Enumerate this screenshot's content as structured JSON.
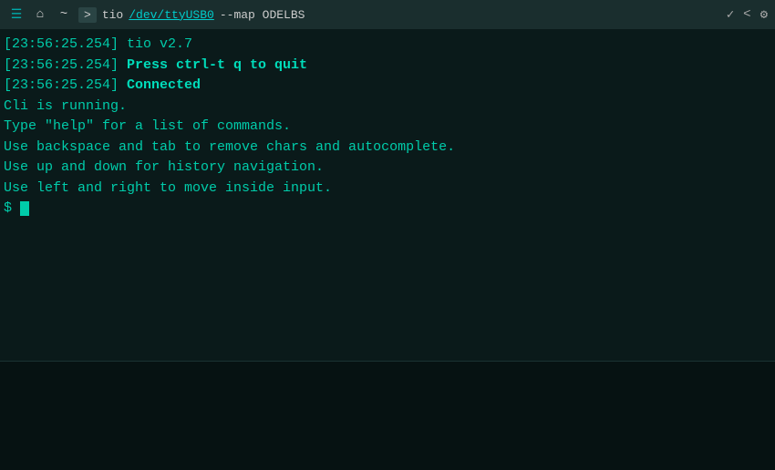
{
  "titlebar": {
    "icons": {
      "bars": "≡",
      "home": "⌂",
      "wave": "~"
    },
    "arrow": ">",
    "cmd_prefix": "tio ",
    "cmd_link": "/dev/ttyUSB0",
    "cmd_rest": " --map ODELBS",
    "actions": {
      "check": "✓",
      "back": "<",
      "settings": "⚙"
    }
  },
  "terminal": {
    "lines": [
      {
        "type": "timestamp-normal",
        "text": "[23:56:25.254] tio v2.7"
      },
      {
        "type": "timestamp-bold",
        "text": "[23:56:25.254] Press ctrl-t q to quit"
      },
      {
        "type": "timestamp-connected",
        "text": "[23:56:25.254] Connected"
      },
      {
        "type": "normal",
        "text": "Cli is running."
      },
      {
        "type": "normal",
        "text": "Type \"help\" for a list of commands."
      },
      {
        "type": "normal",
        "text": "Use backspace and tab to remove chars and autocomplete."
      },
      {
        "type": "normal",
        "text": "Use up and down for history navigation."
      },
      {
        "type": "normal",
        "text": "Use left and right to move inside input."
      },
      {
        "type": "prompt",
        "text": "$ "
      }
    ]
  }
}
